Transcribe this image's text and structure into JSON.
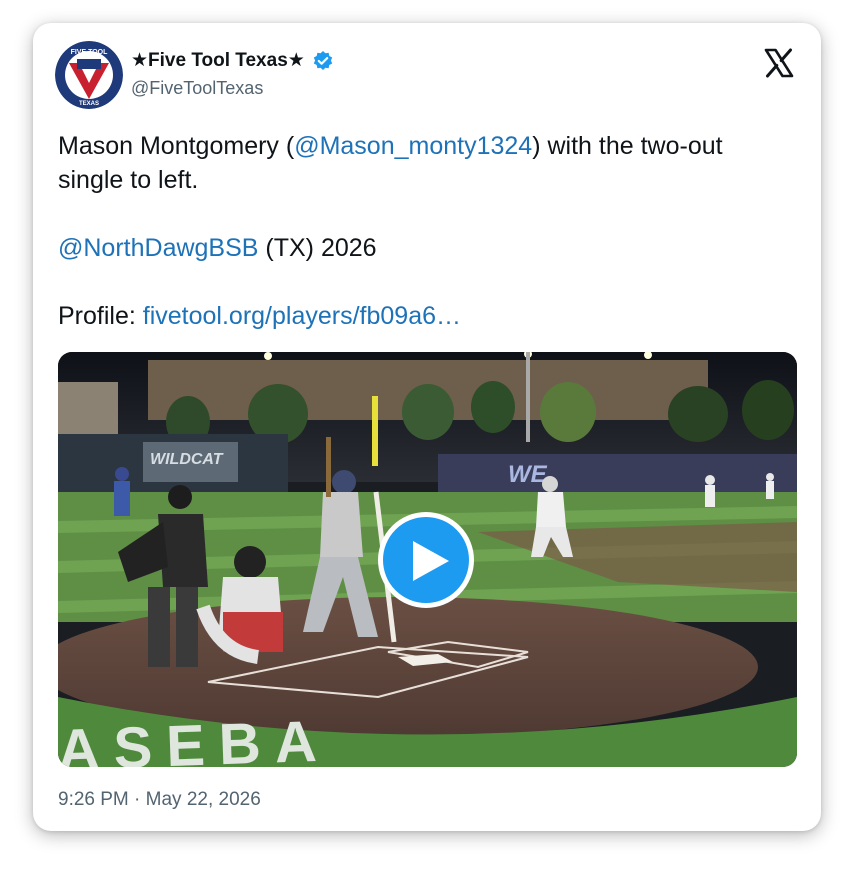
{
  "post": {
    "author": {
      "display_name": "★Five Tool Texas★",
      "handle": "@FiveToolTexas",
      "verified": true,
      "avatar_text_top": "FIVE TOOL",
      "avatar_text_bottom": "TEXAS"
    },
    "text": {
      "line1_before": "Mason Montgomery (",
      "mention1": "@Mason_monty1324",
      "line1_after": ") with the two-out single to left.",
      "mention2": "@NorthDawgBSB",
      "line2_after": " (TX) 2026",
      "profile_label": "Profile: ",
      "profile_link": "fivetool.org/players/fb09a6…"
    },
    "media": {
      "type": "video",
      "field_wall_text": "WILDCAT",
      "outfield_logo": "WE",
      "grass_text": "ASEBA"
    },
    "timestamp": "9:26 PM · May 22, 2026"
  },
  "colors": {
    "link": "#1d72b8",
    "verified": "#1d9bf0",
    "play": "#1d9bf0",
    "text": "#0f1419",
    "muted": "#536471"
  },
  "icons": {
    "platform_logo": "x-logo-icon",
    "verified": "verified-badge-icon",
    "play": "play-icon"
  }
}
